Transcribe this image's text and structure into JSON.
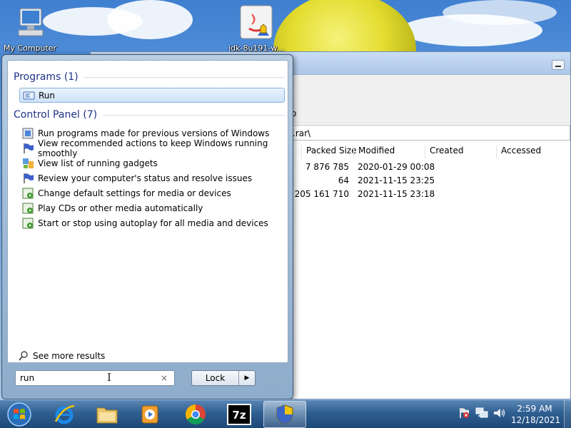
{
  "desktop": {
    "icons": [
      {
        "label": "My Computer"
      },
      {
        "label": "jdk-8u191-w..."
      }
    ]
  },
  "archive_window": {
    "toolbar_letter": "o",
    "path": ".rar\\",
    "columns": [
      "Packed Size",
      "Modified",
      "Created",
      "Accessed"
    ],
    "rows": [
      {
        "packed": "7 876 785",
        "modified": "2020-01-29 00:08"
      },
      {
        "packed": "64",
        "modified": "2021-11-15 23:25"
      },
      {
        "packed": "205 161 710",
        "modified": "2021-11-15 23:18"
      }
    ]
  },
  "start_menu": {
    "programs_header": "Programs (1)",
    "programs": [
      {
        "label": "Run",
        "icon": "run-icon"
      }
    ],
    "control_panel_header": "Control Panel (7)",
    "control_panel": [
      {
        "label": "Run programs made for previous versions of Windows",
        "icon": "compat-icon"
      },
      {
        "label": "View recommended actions to keep Windows running smoothly",
        "icon": "flag-icon"
      },
      {
        "label": "View list of running gadgets",
        "icon": "gadgets-icon"
      },
      {
        "label": "Review your computer's status and resolve issues",
        "icon": "flag-icon"
      },
      {
        "label": "Change default settings for media or devices",
        "icon": "autoplay-icon"
      },
      {
        "label": "Play CDs or other media automatically",
        "icon": "autoplay-icon"
      },
      {
        "label": "Start or stop using autoplay for all media and devices",
        "icon": "autoplay-icon"
      }
    ],
    "see_more": "See more results",
    "search_value": "run",
    "clear_glyph": "×",
    "lock_label": "Lock",
    "lock_arrow": "▶"
  },
  "taskbar": {
    "apps": [
      "start-orb",
      "internet-explorer",
      "file-explorer",
      "media-player",
      "chrome",
      "7-zip",
      "installer"
    ],
    "time": "2:59 AM",
    "date": "12/18/2021"
  }
}
